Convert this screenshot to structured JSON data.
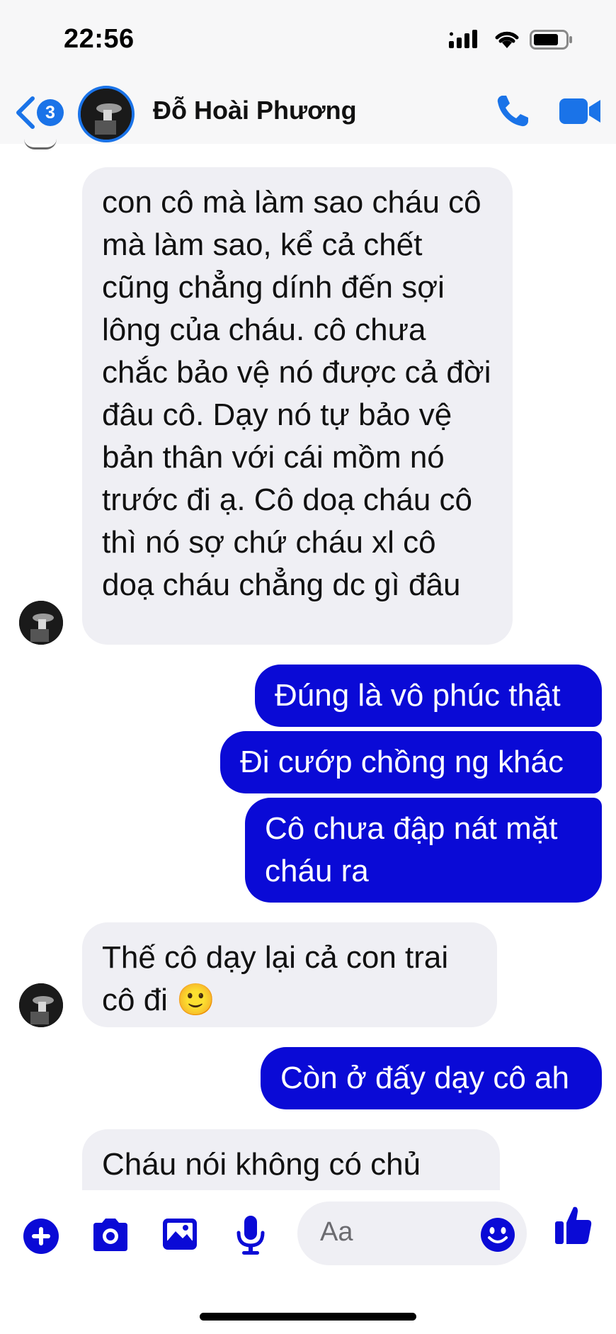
{
  "status_bar": {
    "time": "22:56"
  },
  "header": {
    "unread_count": "3",
    "contact_name": "Đỗ Hoài Phương"
  },
  "messages": [
    {
      "direction": "incoming",
      "text": "con cô mà làm sao cháu cô mà làm sao, kể cả chết cũng chẳng dính đến sợi lông của cháu. cô chưa chắc bảo vệ nó được cả đời đâu cô. Dạy nó tự bảo vệ bản thân với cái mồm nó trước đi ạ. Cô doạ cháu cô thì nó sợ chứ cháu xl cô doạ cháu chẳng dc gì đâu"
    },
    {
      "direction": "outgoing",
      "text": "Đúng là vô phúc thật"
    },
    {
      "direction": "outgoing",
      "text": "Đi cướp chồng ng khác"
    },
    {
      "direction": "outgoing",
      "text": "Cô chưa đập nát mặt cháu ra"
    },
    {
      "direction": "incoming",
      "text": "Thế cô dạy lại cả con trai cô đi 🙂"
    },
    {
      "direction": "outgoing",
      "text": "Còn ở đấy dạy cô ah"
    },
    {
      "direction": "incoming",
      "text": "Cháu nói không có chủ"
    }
  ],
  "composer": {
    "placeholder": "Aa"
  },
  "colors": {
    "accent": "#1a73e8",
    "outgoing_bubble": "#0a0ad6",
    "incoming_bubble": "#efeff4"
  },
  "icons": [
    "back-chevron-icon",
    "phone-icon",
    "video-camera-icon",
    "plus-icon",
    "camera-icon",
    "photo-icon",
    "microphone-icon",
    "emoji-icon",
    "thumbs-up-icon"
  ]
}
